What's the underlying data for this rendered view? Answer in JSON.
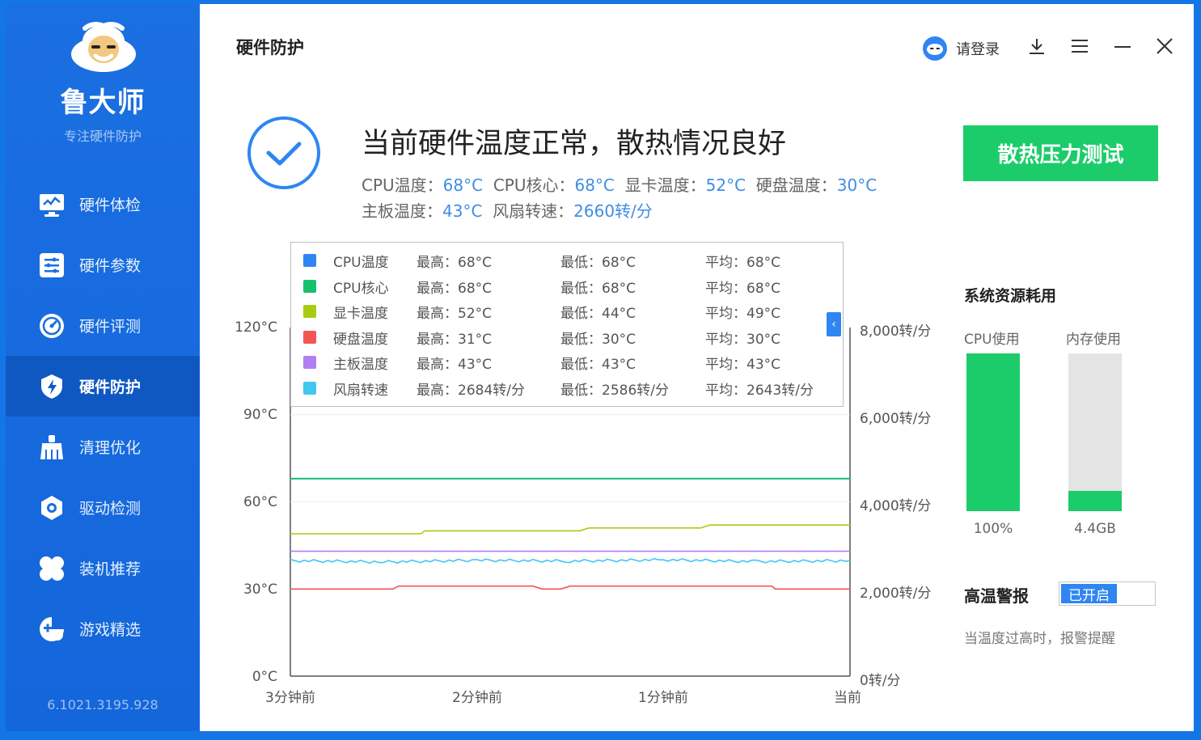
{
  "app": {
    "brand": "鲁大师",
    "slogan": "专注硬件防护",
    "version": "6.1021.3195.928"
  },
  "sidebar": {
    "items": [
      {
        "label": "硬件体检",
        "icon": "monitor-check-icon",
        "active": false
      },
      {
        "label": "硬件参数",
        "icon": "list-settings-icon",
        "active": false
      },
      {
        "label": "硬件评测",
        "icon": "speedometer-icon",
        "active": false
      },
      {
        "label": "硬件防护",
        "icon": "shield-bolt-icon",
        "active": true
      },
      {
        "label": "清理优化",
        "icon": "broom-icon",
        "active": false
      },
      {
        "label": "驱动检测",
        "icon": "gear-icon",
        "active": false
      },
      {
        "label": "装机推荐",
        "icon": "puzzle-icon",
        "active": false
      },
      {
        "label": "游戏精选",
        "icon": "gamepad-icon",
        "active": false
      }
    ]
  },
  "header": {
    "title": "硬件防护",
    "login_label": "请登录"
  },
  "status": {
    "headline": "当前硬件温度正常，散热情况良好",
    "line1": [
      {
        "label": "CPU温度：",
        "value": "68°C"
      },
      {
        "label": "CPU核心：",
        "value": "68°C"
      },
      {
        "label": "显卡温度：",
        "value": "52°C"
      },
      {
        "label": "硬盘温度：",
        "value": "30°C"
      }
    ],
    "line2": [
      {
        "label": "主板温度：",
        "value": "43°C"
      },
      {
        "label": "风扇转速：",
        "value": "2660转/分"
      }
    ],
    "stress_test_label": "散热压力测试"
  },
  "legend": [
    {
      "name": "CPU温度",
      "color": "#2f86f2",
      "max": "最高：68°C",
      "min": "最低：68°C",
      "avg": "平均：68°C"
    },
    {
      "name": "CPU核心",
      "color": "#17c16b",
      "max": "最高：68°C",
      "min": "最低：68°C",
      "avg": "平均：68°C"
    },
    {
      "name": "显卡温度",
      "color": "#a9cc12",
      "max": "最高：52°C",
      "min": "最低：44°C",
      "avg": "平均：49°C"
    },
    {
      "name": "硬盘温度",
      "color": "#f35553",
      "max": "最高：31°C",
      "min": "最低：30°C",
      "avg": "平均：30°C"
    },
    {
      "name": "主板温度",
      "color": "#b07ef0",
      "max": "最高：43°C",
      "min": "最低：43°C",
      "avg": "平均：43°C"
    },
    {
      "name": "风扇转速",
      "color": "#43c7ef",
      "max": "最高：2684转/分",
      "min": "最低：2586转/分",
      "avg": "平均：2643转/分"
    }
  ],
  "chart_data": {
    "type": "line",
    "x_ticks": [
      "3分钟前",
      "2分钟前",
      "1分钟前",
      "当前"
    ],
    "y_left_ticks": [
      "0°C",
      "30°C",
      "60°C",
      "90°C",
      "120°C"
    ],
    "y_left_range": [
      0,
      120
    ],
    "y_right_ticks": [
      "0转/分",
      "2,000转/分",
      "4,000转/分",
      "6,000转/分",
      "8,000转/分"
    ],
    "y_right_range": [
      0,
      8000
    ],
    "x_minutes_ago_range": [
      3,
      0
    ],
    "series": [
      {
        "name": "CPU温度",
        "axis": "left",
        "color": "#2f86f2",
        "points": [
          [
            3,
            68
          ],
          [
            0,
            68
          ]
        ]
      },
      {
        "name": "CPU核心",
        "axis": "left",
        "color": "#17c16b",
        "points": [
          [
            3,
            68
          ],
          [
            0,
            68
          ]
        ]
      },
      {
        "name": "显卡温度",
        "axis": "left",
        "color": "#a9cc12",
        "points": [
          [
            3,
            49
          ],
          [
            2.3,
            49
          ],
          [
            2.28,
            50
          ],
          [
            1.45,
            50
          ],
          [
            1.4,
            51
          ],
          [
            0.8,
            51
          ],
          [
            0.75,
            52
          ],
          [
            0,
            52
          ]
        ]
      },
      {
        "name": "硬盘温度",
        "axis": "left",
        "color": "#f35553",
        "points": [
          [
            3,
            30
          ],
          [
            2.45,
            30
          ],
          [
            2.42,
            31
          ],
          [
            1.7,
            31
          ],
          [
            1.65,
            30
          ],
          [
            1.55,
            30
          ],
          [
            1.5,
            31
          ],
          [
            0.42,
            31
          ],
          [
            0.4,
            30
          ],
          [
            0,
            30
          ]
        ]
      },
      {
        "name": "主板温度",
        "axis": "left",
        "color": "#b07ef0",
        "points": [
          [
            3,
            43
          ],
          [
            0,
            43
          ]
        ]
      },
      {
        "name": "风扇转速",
        "axis": "right",
        "color": "#43c7ef",
        "points": [
          [
            3,
            2650
          ],
          [
            2.5,
            2620
          ],
          [
            2,
            2660
          ],
          [
            1.5,
            2640
          ],
          [
            1,
            2670
          ],
          [
            0.5,
            2630
          ],
          [
            0,
            2650
          ]
        ]
      }
    ]
  },
  "resources": {
    "title": "系统资源耗用",
    "cpu": {
      "label": "CPU使用",
      "value": "100%",
      "fill_fraction": 1.0
    },
    "memory": {
      "label": "内存使用",
      "value": "4.4GB",
      "fill_fraction": 0.13
    }
  },
  "alarm": {
    "title": "高温警报",
    "toggle_label": "已开启",
    "description": "当温度过高时，报警提醒"
  },
  "colors": {
    "sidebar": "#1a6fe1",
    "active_nav": "#0f58c2",
    "accent_green": "#1ccc6a",
    "accent_blue": "#2f86f2"
  }
}
